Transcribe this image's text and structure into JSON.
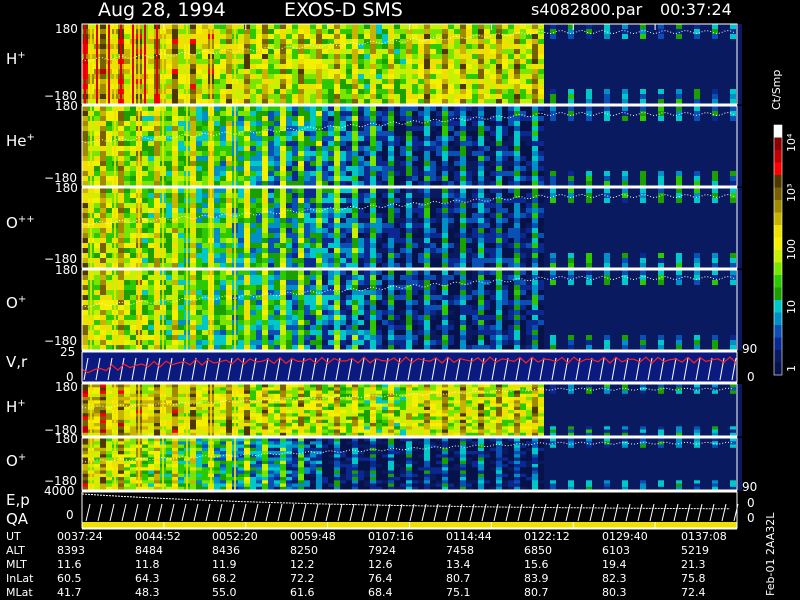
{
  "header": {
    "date": "Aug 28, 1994",
    "instrument": "EXOS-D SMS",
    "file": "s4082800.par",
    "time": "00:37:24"
  },
  "panels": [
    {
      "id": "h-plus",
      "label": "H",
      "sup": "+",
      "top_tick": "180",
      "bottom_tick": "−180"
    },
    {
      "id": "he-plus",
      "label": "He",
      "sup": "+",
      "top_tick": "180",
      "bottom_tick": "−180"
    },
    {
      "id": "o-plusplus",
      "label": "O",
      "sup": "++",
      "top_tick": "180",
      "bottom_tick": "−180"
    },
    {
      "id": "o-plus",
      "label": "O",
      "sup": "+",
      "top_tick": "",
      "bottom_tick": "−180"
    },
    {
      "id": "vr",
      "label": "V,r",
      "sup": "",
      "top_tick": "25",
      "bottom_tick": "0"
    },
    {
      "id": "h-plus-2",
      "label": "H",
      "sup": "+",
      "top_tick": "180",
      "bottom_tick": "−180"
    },
    {
      "id": "o-plus-2",
      "label": "O",
      "sup": "+",
      "top_tick": "180",
      "bottom_tick": "−180"
    },
    {
      "id": "ep-qa",
      "label": "E,p",
      "sup": "",
      "top_tick": "4000",
      "bottom_tick": "0"
    }
  ],
  "qa_label": "QA",
  "right_axis": {
    "vr_top": "90",
    "vr_bottom": "0",
    "ep_top": "90",
    "ep_mid": "0",
    "ep_bottom": "0"
  },
  "colorbar": {
    "title": "Ct/Smp",
    "ticks": [
      "10⁴",
      "10³",
      "100",
      "10",
      "1"
    ],
    "colors": [
      "#ffffff",
      "#8b0000",
      "#c00000",
      "#ff0000",
      "#4d3800",
      "#786000",
      "#a08a00",
      "#c8b400",
      "#f0e000",
      "#f5f000",
      "#c8f000",
      "#78e600",
      "#2cc800",
      "#1aa000",
      "#00c8c8",
      "#0090c8",
      "#0a50b4",
      "#0a2890",
      "#0a1a60",
      "#06124a"
    ]
  },
  "side_text": "Feb-01 2AA32L",
  "rows": [
    {
      "label": "UT",
      "values": [
        "0037:24",
        "0044:52",
        "0052:20",
        "0059:48",
        "0107:16",
        "0114:44",
        "0122:12",
        "0129:40",
        "0137:08"
      ]
    },
    {
      "label": "ALT",
      "values": [
        "8393",
        "8484",
        "8436",
        "8250",
        "7924",
        "7458",
        "6850",
        "6103",
        "5219"
      ]
    },
    {
      "label": "MLT",
      "values": [
        "11.6",
        "11.8",
        "11.9",
        "12.2",
        "12.6",
        "13.4",
        "15.6",
        "19.4",
        "21.3"
      ]
    },
    {
      "label": "InLat",
      "values": [
        "60.5",
        "64.3",
        "68.2",
        "72.2",
        "76.4",
        "80.7",
        "83.9",
        "82.3",
        "75.8"
      ]
    },
    {
      "label": "MLat",
      "values": [
        "41.7",
        "48.3",
        "55.0",
        "61.6",
        "68.4",
        "75.1",
        "80.7",
        "80.3",
        "72.4"
      ]
    }
  ],
  "chart_data": {
    "type": "heatmap",
    "title": "Aug 28, 1994 EXOS-D SMS",
    "x": [
      "0037:24",
      "0044:52",
      "0052:20",
      "0059:48",
      "0107:16",
      "0114:44",
      "0122:12",
      "0129:40",
      "0137:08"
    ],
    "series": [
      {
        "name": "H+",
        "ylim": [
          -180,
          180
        ]
      },
      {
        "name": "He+",
        "ylim": [
          -180,
          180
        ]
      },
      {
        "name": "O++",
        "ylim": [
          -180,
          180
        ]
      },
      {
        "name": "O+",
        "ylim": [
          -180,
          180
        ]
      },
      {
        "name": "V,r",
        "ylim": [
          0,
          25
        ]
      },
      {
        "name": "H+",
        "ylim": [
          -180,
          180
        ]
      },
      {
        "name": "O+",
        "ylim": [
          -180,
          180
        ]
      },
      {
        "name": "E,p",
        "ylim": [
          0,
          4000
        ]
      }
    ],
    "colorbar": {
      "label": "Ct/Smp",
      "range": [
        1,
        10000
      ],
      "scale": "log"
    }
  }
}
